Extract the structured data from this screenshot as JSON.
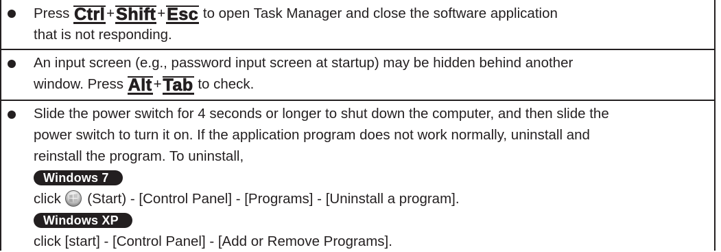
{
  "items": [
    {
      "prefix": "Press ",
      "keys": [
        "Ctrl",
        "Shift",
        "Esc"
      ],
      "plus": "+",
      "suffix": " to open Task Manager and close the software application",
      "line2": "that is not responding."
    },
    {
      "line1": "An input screen (e.g., password input screen at startup) may be hidden behind another",
      "prefix": "window. Press ",
      "keys": [
        "Alt",
        "Tab"
      ],
      "plus": "+",
      "suffix": " to check."
    },
    {
      "line1": "Slide the power switch for 4 seconds or longer to shut down the computer, and then slide the",
      "line2": "power switch to turn it on. If the application program does not work normally, uninstall and",
      "line3": "reinstall the program. To uninstall,",
      "os1": "Windows 7",
      "os1_prefix": "click ",
      "os1_icon": "windows-start-orb-icon",
      "os1_text": " (Start) - [Control Panel] - [Programs] - [Uninstall a program].",
      "os2": "Windows XP",
      "os2_text": "click [start] - [Control Panel] - [Add or Remove Programs]."
    }
  ]
}
